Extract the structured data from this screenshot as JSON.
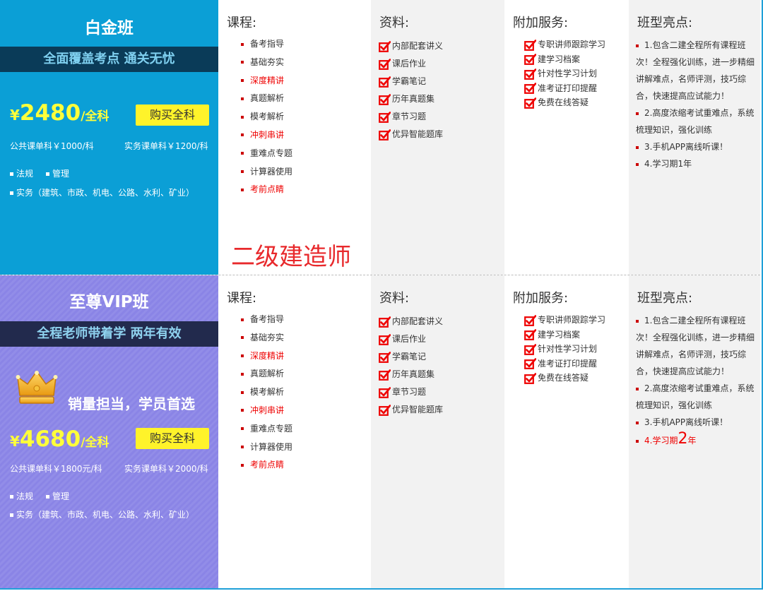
{
  "banner": "二级建造师",
  "headers": {
    "courses": "课程:",
    "materials": "资料:",
    "services": "附加服务:",
    "highlights": "班型亮点:"
  },
  "courses": [
    {
      "label": "备考指导",
      "red": false
    },
    {
      "label": "基础夯实",
      "red": false
    },
    {
      "label": "深度精讲",
      "red": true
    },
    {
      "label": "真题解析",
      "red": false
    },
    {
      "label": "模考解析",
      "red": false
    },
    {
      "label": "冲刺串讲",
      "red": true
    },
    {
      "label": "重难点专题",
      "red": false
    },
    {
      "label": "计算器使用",
      "red": false
    },
    {
      "label": "考前点睛",
      "red": true
    }
  ],
  "materials": [
    "内部配套讲义",
    "课后作业",
    "学霸笔记",
    "历年真题集",
    "章节习题",
    "优异智能题库"
  ],
  "services": [
    "专职讲师跟踪学习",
    "建学习档案",
    "针对性学习计划",
    "准考证打印提醒",
    "免费在线答疑"
  ],
  "colors": {
    "accent_red": "#e00000",
    "blue_panel": "#0b9fd6",
    "purple_panel": "#8a84e6",
    "buy_yellow": "#fff32a",
    "price_yellow": "#ffff3a"
  },
  "icons": {
    "check": "checkbox-check-icon",
    "crown": "crown-icon"
  },
  "plans": [
    {
      "title": "白金班",
      "subtitle": "全面覆盖考点 通关无忧",
      "price_yen": "¥",
      "price_num": "2480",
      "price_unit": "/全科",
      "buy_label": "购买全科",
      "public_price": "公共课单科￥1000/科",
      "practice_price": "实务课单科￥1200/科",
      "subject_law": "法规",
      "subject_mgmt": "管理",
      "subject_practice": "实务（建筑、市政、机电、公路、水利、矿业）",
      "highlights": {
        "h1": "1.包含二建全程所有课程班次！全程强化训练，进一步精细讲解难点，名师评测，技巧综合，快速提高应试能力！",
        "h2": "2.高度浓缩考试重难点，系统梳理知识，强化训练",
        "h3": "3.手机APP离线听课！",
        "h4": "4.学习期1年"
      }
    },
    {
      "title": "至尊VIP班",
      "subtitle": "全程老师带着学 两年有效",
      "slogan": "销量担当，学员首选",
      "price_yen": "¥",
      "price_num": "4680",
      "price_unit": "/全科",
      "buy_label": "购买全科",
      "public_price": "公共课单科￥1800元/科",
      "practice_price": "实务课单科￥2000/科",
      "subject_law": "法规",
      "subject_mgmt": "管理",
      "subject_practice": "实务（建筑、市政、机电、公路、水利、矿业）",
      "highlights": {
        "h1": "1.包含二建全程所有课程班次！全程强化训练，进一步精细讲解难点，名师评测，技巧综合，快速提高应试能力！",
        "h2": "2.高度浓缩考试重难点，系统梳理知识，强化训练",
        "h3": "3.手机APP离线听课！",
        "h4_pre": "4.学习期",
        "h4_big": "2",
        "h4_post": "年"
      }
    }
  ]
}
